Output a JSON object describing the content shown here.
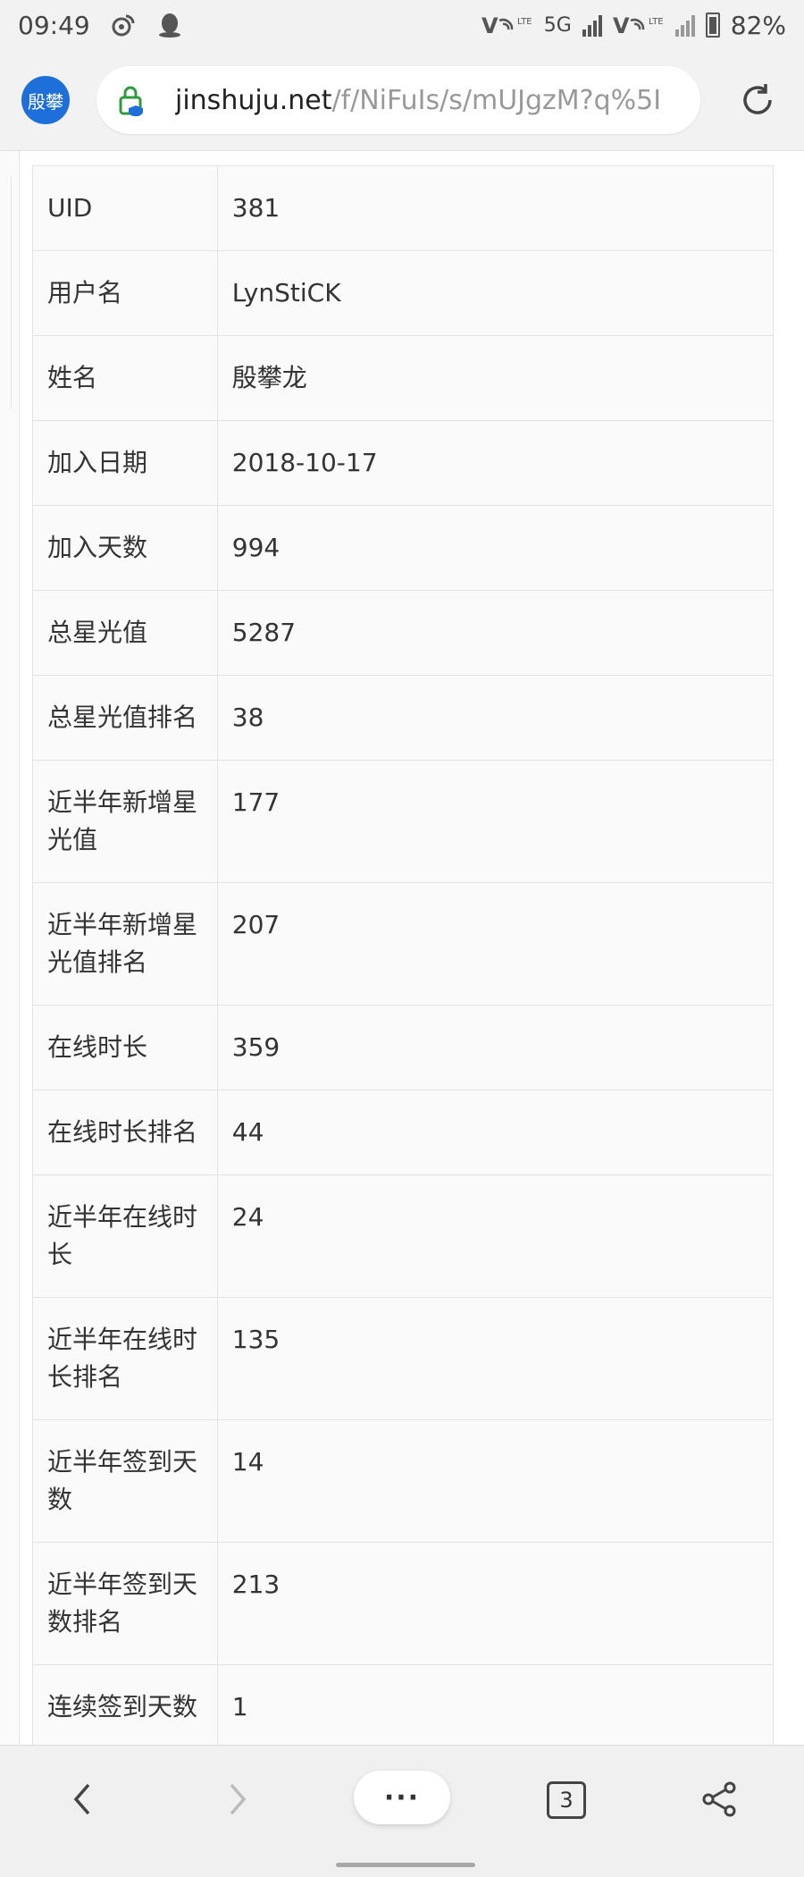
{
  "status_bar": {
    "time": "09:49",
    "network_1": "5G",
    "battery_percent": "82%",
    "icons": [
      "weibo-icon",
      "qq-icon",
      "volte-icon",
      "signal-icon",
      "battery-icon"
    ]
  },
  "browser": {
    "site_badge": "殷攀",
    "url_host": "jinshuju.net",
    "url_path": "/f/NiFuIs/s/mUJgzM?q%5I"
  },
  "table": {
    "rows": [
      {
        "label": "UID",
        "value": "381"
      },
      {
        "label": "用户名",
        "value": "LynStiCK"
      },
      {
        "label": "姓名",
        "value": "殷攀龙"
      },
      {
        "label": "加入日期",
        "value": "2018-10-17"
      },
      {
        "label": "加入天数",
        "value": "994"
      },
      {
        "label": "总星光值",
        "value": "5287"
      },
      {
        "label": "总星光值排名",
        "value": "38"
      },
      {
        "label": "近半年新增星光值",
        "value": "177"
      },
      {
        "label": "近半年新增星光值排名",
        "value": "207"
      },
      {
        "label": "在线时长",
        "value": "359"
      },
      {
        "label": "在线时长排名",
        "value": "44"
      },
      {
        "label": "近半年在线时长",
        "value": "24"
      },
      {
        "label": "近半年在线时长排名",
        "value": "135"
      },
      {
        "label": "近半年签到天数",
        "value": "14"
      },
      {
        "label": "近半年签到天数排名",
        "value": "213"
      },
      {
        "label": "连续签到天数",
        "value": "1"
      }
    ]
  },
  "bottom_nav": {
    "menu_label": "···",
    "tab_count": "3"
  }
}
